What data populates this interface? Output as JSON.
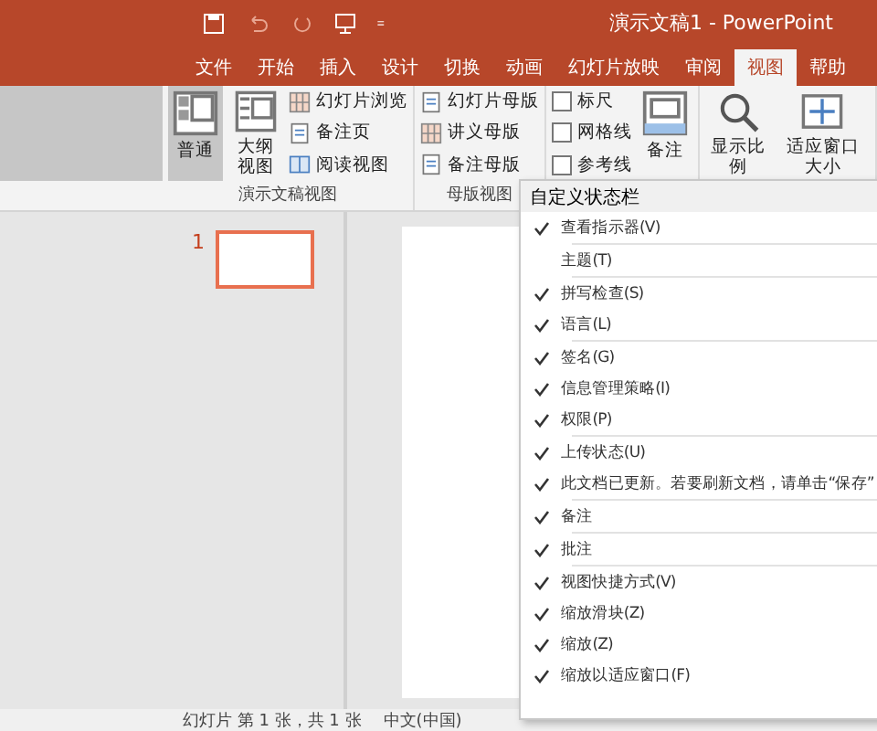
{
  "window": {
    "title": "演示文稿1 - PowerPoint"
  },
  "tabs": [
    {
      "label": "文件",
      "selected": false
    },
    {
      "label": "开始",
      "selected": false
    },
    {
      "label": "插入",
      "selected": false
    },
    {
      "label": "设计",
      "selected": false
    },
    {
      "label": "切换",
      "selected": false
    },
    {
      "label": "动画",
      "selected": false
    },
    {
      "label": "幻灯片放映",
      "selected": false
    },
    {
      "label": "审阅",
      "selected": false
    },
    {
      "label": "视图",
      "selected": true
    },
    {
      "label": "帮助",
      "selected": false
    }
  ],
  "ribbon": {
    "groups": [
      {
        "label": "演示文稿视图",
        "items": [
          {
            "kind": "large",
            "label": "普通",
            "selected": true
          },
          {
            "kind": "large",
            "label": "大纲视图",
            "selected": false
          },
          {
            "kind": "stack",
            "items": [
              {
                "label": "幻灯片浏览"
              },
              {
                "label": "备注页"
              },
              {
                "label": "阅读视图"
              }
            ]
          }
        ]
      },
      {
        "label": "母版视图",
        "items": [
          {
            "kind": "stack",
            "items": [
              {
                "label": "幻灯片母版"
              },
              {
                "label": "讲义母版"
              },
              {
                "label": "备注母版"
              }
            ]
          }
        ]
      },
      {
        "items": [
          {
            "kind": "checks",
            "items": [
              {
                "label": "标尺",
                "checked": false
              },
              {
                "label": "网格线",
                "checked": false
              },
              {
                "label": "参考线",
                "checked": false
              }
            ]
          },
          {
            "kind": "large",
            "label": "备注",
            "selected": false
          }
        ]
      },
      {
        "items": [
          {
            "kind": "large",
            "label": "显示比例",
            "selected": false
          },
          {
            "kind": "large",
            "label": "适应窗口大小",
            "selected": false
          }
        ]
      }
    ]
  },
  "thumbnails": [
    {
      "number": "1",
      "selected": true
    }
  ],
  "status_bar": {
    "items": [
      "幻灯片 第 1 张，共 1 张",
      "中文(中国)"
    ]
  },
  "context_menu": {
    "title": "自定义状态栏",
    "groups": [
      [
        {
          "label": "查看指示器(V)",
          "checked": true
        }
      ],
      [
        {
          "label": "主题(T)",
          "checked": false
        }
      ],
      [
        {
          "label": "拼写检查(S)",
          "checked": true
        },
        {
          "label": "语言(L)",
          "checked": true
        }
      ],
      [
        {
          "label": "签名(G)",
          "checked": true
        },
        {
          "label": "信息管理策略(I)",
          "checked": true
        },
        {
          "label": "权限(P)",
          "checked": true
        }
      ],
      [
        {
          "label": "上传状态(U)",
          "checked": true
        },
        {
          "label": "此文档已更新。若要刷新文档，请单击“保存”",
          "checked": true
        }
      ],
      [
        {
          "label": "备注",
          "checked": true
        }
      ],
      [
        {
          "label": "批注",
          "checked": true
        }
      ],
      [
        {
          "label": "视图快捷方式(V)",
          "checked": true
        },
        {
          "label": "缩放滑块(Z)",
          "checked": true
        },
        {
          "label": "缩放(Z)",
          "checked": true
        },
        {
          "label": "缩放以适应窗口(F)",
          "checked": true
        }
      ]
    ]
  }
}
